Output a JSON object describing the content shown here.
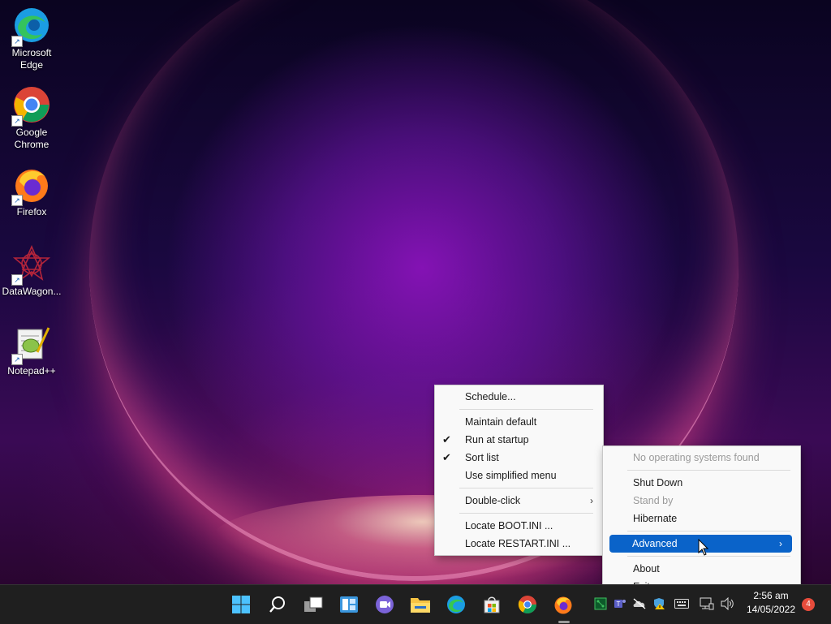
{
  "desktop": {
    "icons": [
      {
        "label_line1": "Microsoft",
        "label_line2": "Edge",
        "icon": "edge-icon"
      },
      {
        "label_line1": "Google",
        "label_line2": "Chrome",
        "icon": "chrome-icon"
      },
      {
        "label_line1": "Firefox",
        "label_line2": "",
        "icon": "firefox-icon"
      },
      {
        "label_line1": "DataWagon...",
        "label_line2": "",
        "icon": "datawagon-icon"
      },
      {
        "label_line1": "Notepad++",
        "label_line2": "",
        "icon": "notepadpp-icon"
      }
    ]
  },
  "main_menu": {
    "items": [
      {
        "label": "Schedule..."
      },
      {
        "label": "Maintain default"
      },
      {
        "label": "Run at startup",
        "checked": true
      },
      {
        "label": "Sort list",
        "checked": true
      },
      {
        "label": "Use simplified menu"
      },
      {
        "label": "Double-click",
        "submenu_arrow": "›"
      },
      {
        "label": "Locate BOOT.INI ..."
      },
      {
        "label": "Locate RESTART.INI ..."
      }
    ],
    "check_glyph": "✔"
  },
  "sub_menu": {
    "items": [
      {
        "label": "No operating systems found",
        "disabled": true
      },
      {
        "label": "Shut Down"
      },
      {
        "label": "Stand by",
        "disabled": true
      },
      {
        "label": "Hibernate"
      },
      {
        "label": "Advanced",
        "highlighted": true,
        "submenu_arrow": "›"
      },
      {
        "label": "About"
      },
      {
        "label": "Exit"
      }
    ]
  },
  "taskbar": {
    "apps": [
      "start-icon",
      "search-icon",
      "task-view-icon",
      "widgets-icon",
      "teams-chat-icon",
      "file-explorer-icon",
      "edge-icon",
      "store-icon",
      "chrome-icon",
      "firefox-icon"
    ],
    "tray": [
      "network-tray-icon",
      "teams-tray-icon",
      "onedrive-offline-icon",
      "defender-warning-icon",
      "keyboard-icon",
      "network-icon",
      "volume-icon"
    ],
    "clock_time": "2:56 am",
    "clock_date": "14/05/2022",
    "notification_count": "4"
  },
  "colors": {
    "highlight": "#0a63c9",
    "taskbar": "#1f1f1f",
    "menu_bg": "#f9f9f9"
  }
}
